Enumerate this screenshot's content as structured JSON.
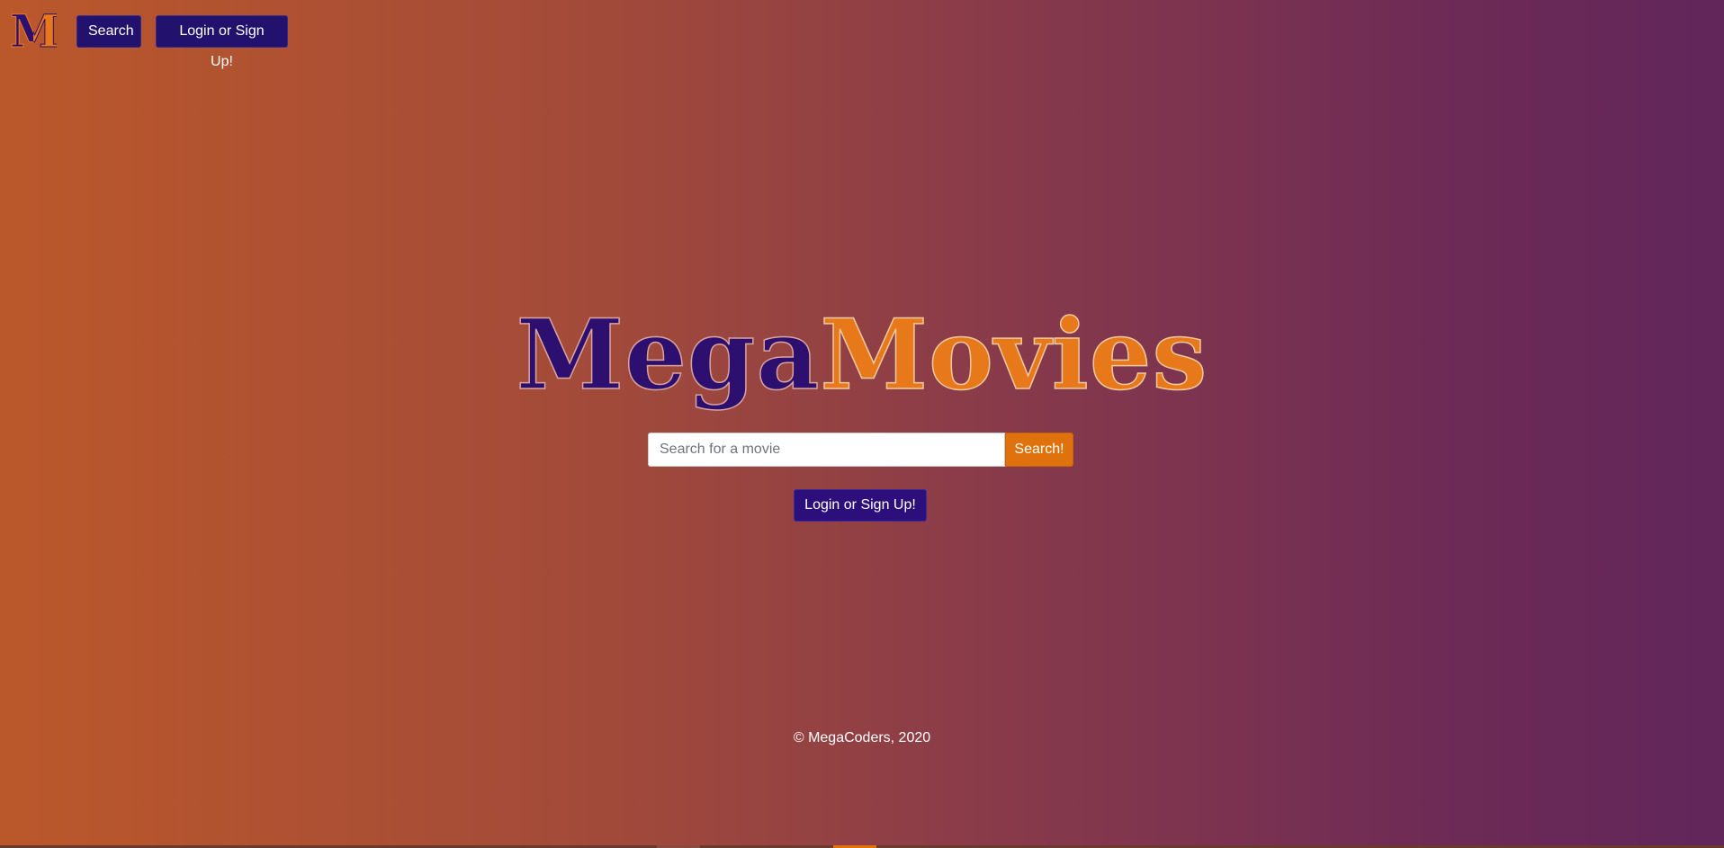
{
  "brand": {
    "logo_letter": "M",
    "colors": {
      "purple": "#2c0f6e",
      "orange": "#e8791a"
    }
  },
  "nav": {
    "search_label": "Search",
    "login_label": "Login or Sign Up!"
  },
  "hero": {
    "title_part1": "Mega",
    "title_part2": "Movies",
    "search_placeholder": "Search for a movie",
    "search_value": "",
    "search_button_label": "Search!",
    "login_button_label": "Login or Sign Up!"
  },
  "footer": {
    "copyright": "© MegaCoders, 2020"
  },
  "theme": {
    "gradient_left": "#bb582b",
    "gradient_right": "#62265b",
    "button_dark": "#22126e",
    "button_orange": "#e0720e"
  }
}
